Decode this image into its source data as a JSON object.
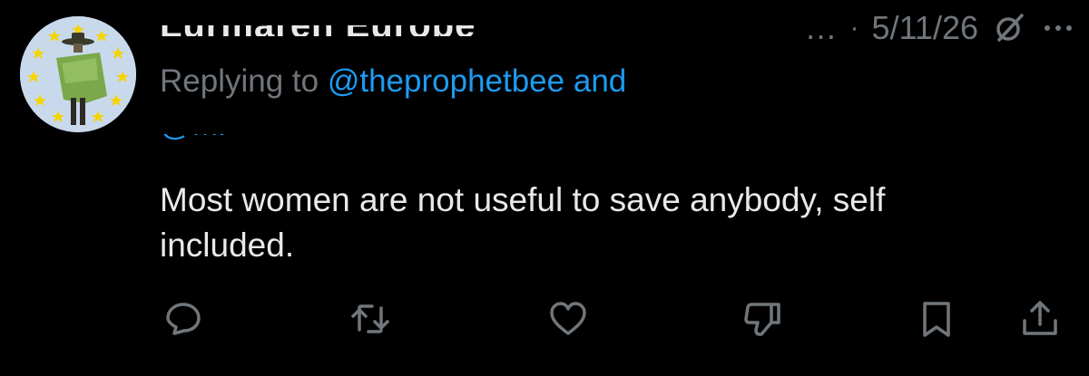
{
  "author": {
    "name_fragment": "Lurmaren Europe",
    "avatar_icon": "eu-stars-cowboy-avatar"
  },
  "meta": {
    "more_dots": "…",
    "separator": "·",
    "date": "5/11/26",
    "grok_icon": "grok-icon",
    "more_icon": "more-options-icon"
  },
  "reply": {
    "prefix": "Replying to ",
    "handle": "@theprophetbee",
    "suffix": " and",
    "second_handle_fragment": "@Mi"
  },
  "tweet": {
    "text_line1": "Most women are not useful to save anybody, self",
    "text_line2": "included."
  },
  "actions": {
    "reply_icon": "reply-icon",
    "retweet_icon": "retweet-icon",
    "like_icon": "heart-icon",
    "dislike_icon": "thumbs-down-icon",
    "bookmark_icon": "bookmark-icon",
    "share_icon": "share-icon"
  },
  "colors": {
    "background": "#000000",
    "text": "#e7e9ea",
    "secondary": "#71767b",
    "link": "#1d9bf0",
    "avatar_bg": "#c9d9ec",
    "eu_star": "#f5d400"
  }
}
